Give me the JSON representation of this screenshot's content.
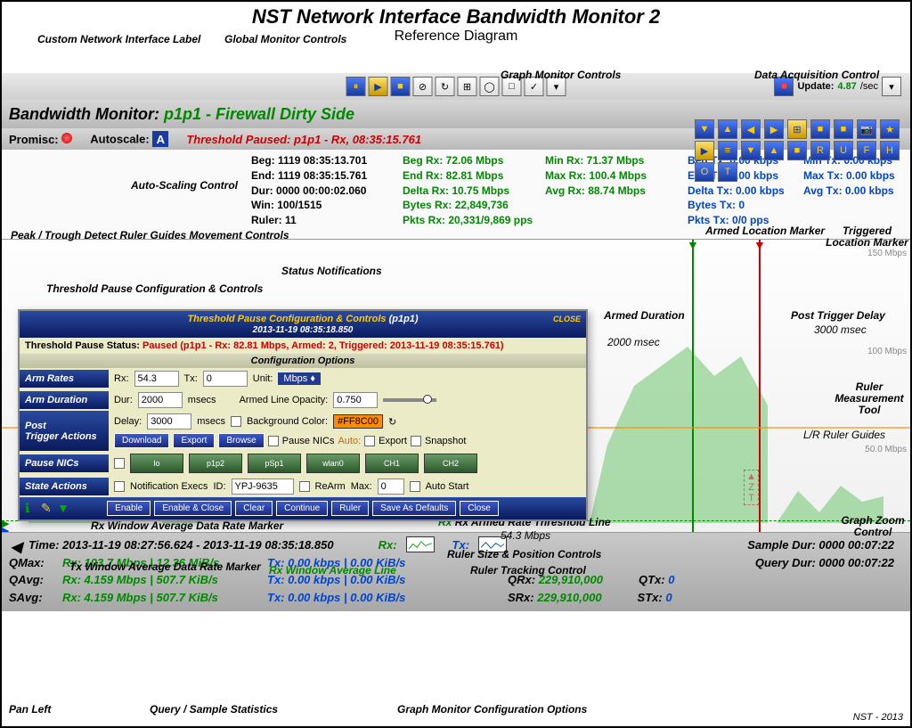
{
  "header": {
    "title": "NST Network Interface Bandwidth Monitor 2",
    "subtitle": "Reference Diagram"
  },
  "callouts": {
    "custom_label": "Custom Network\nInterface Label",
    "global_controls": "Global\nMonitor Controls",
    "graph_controls": "Graph Monitor Controls",
    "data_acq": "Data Acquisition Control",
    "autoscale": "Auto-Scaling\nControl",
    "peak_trough": "Peak / Trough Detect\nRuler Guides Movement Controls",
    "threshold_cfg": "Threshold Pause\nConfiguration & Controls",
    "status_notif": "Status\nNotifications",
    "armed_marker": "Armed\nLocation\nMarker",
    "triggered_marker": "Triggered\nLocation\nMarker",
    "armed_dur": "Armed\nDuration",
    "armed_dur_val": "2000 msec",
    "post_trigger": "Post Trigger Delay",
    "post_trigger_val": "3000 msec",
    "ruler_tool": "Ruler\nMeasurement\nTool",
    "lr_ruler": "L/R Ruler Guides",
    "rx_win_avg_marker": "Rx Window Average\nData Rate Marker",
    "tx_win_avg_marker": "Tx Window Average\nData Rate Marker",
    "rx_win_avg_line": "Rx Window Average Line",
    "rx_armed_line": "Rx Armed Rate Threshold Line",
    "rx_armed_val": "54.3 Mbps",
    "ruler_size_pos": "Ruler Size & Position Controls",
    "ruler_tracking": "Ruler Tracking Control",
    "graph_zoom": "Graph Zoom\nControl",
    "pan_left": "Pan Left",
    "query_stats": "Query / Sample Statistics",
    "graph_config": "Graph Monitor Configuration Options"
  },
  "monitor": {
    "title_prefix": "Bandwidth Monitor: ",
    "interface": "p1p1 - Firewall Dirty Side",
    "promisc_label": "Promisc:",
    "autoscale_label": "Autoscale:",
    "threshold_msg": "Threshold Paused: p1p1 - Rx, 08:35:15.761"
  },
  "data_acq": {
    "update_label": "Update:",
    "rate": "4.87",
    "per": "/sec"
  },
  "timing": {
    "beg_label": "Beg:",
    "beg": "1119 08:35:13.701",
    "end_label": "End:",
    "end": "1119 08:35:15.761",
    "dur_label": "Dur:",
    "dur": "0000 00:00:02.060",
    "win_label": "Win:",
    "win": "100/1515",
    "ruler_label": "Ruler:",
    "ruler": "11"
  },
  "rx_stats": {
    "beg": "Beg Rx: 72.06 Mbps",
    "end": "End Rx: 82.81 Mbps",
    "delta": "Delta Rx: 10.75 Mbps",
    "bytes": "Bytes Rx: 22,849,736",
    "pkts": "Pkts Rx: 20,331/9,869 pps"
  },
  "rx_minmax": {
    "min": "Min Rx: 71.37 Mbps",
    "max": "Max Rx: 100.4 Mbps",
    "avg": "Avg Rx: 88.74 Mbps"
  },
  "tx_stats": {
    "beg": "Beg Tx: 0.00 kbps",
    "end": "End Tx: 0.00 kbps",
    "delta": "Delta Tx: 0.00 kbps",
    "bytes": "Bytes Tx: 0",
    "pkts": "Pkts Tx: 0/0 pps"
  },
  "tx_minmax": {
    "min": "Min Tx: 0.00 kbps",
    "max": "Max Tx: 0.00 kbps",
    "avg": "Avg Tx: 0.00 kbps"
  },
  "config": {
    "title": "Threshold Pause Configuration & Controls",
    "iface": "(p1p1)",
    "timestamp": "2013-11-19 08:35:18.850",
    "status_label": "Threshold Pause Status:",
    "status": "Paused (p1p1 - Rx: 82.81 Mbps, Armed: 2, Triggered: 2013-11-19 08:35:15.761)",
    "section": "Configuration Options",
    "arm_rates": "Arm Rates",
    "rx_label": "Rx:",
    "rx": "54.3",
    "tx_label": "Tx:",
    "tx": "0",
    "unit_label": "Unit:",
    "unit": "Mbps",
    "arm_dur_label": "Arm Duration",
    "dur_label": "Dur:",
    "dur": "2000",
    "msecs": "msecs",
    "opacity_label": "Armed Line Opacity:",
    "opacity": "0.750",
    "post_trigger_label": "Post\nTrigger Actions",
    "delay_label": "Delay:",
    "delay": "3000",
    "bg_label": "Background Color:",
    "bg": "#FF8C00",
    "download": "Download",
    "export": "Export",
    "browse": "Browse",
    "pause_nics_cb": "Pause NICs",
    "auto_label": "Auto:",
    "export_cb": "Export",
    "snapshot_cb": "Snapshot",
    "pause_nics_label": "Pause NICs",
    "nics": [
      "lo",
      "p1p2",
      "pSp1",
      "wlan0",
      "CH1",
      "CH2"
    ],
    "state_label": "State Actions",
    "notif_cb": "Notification Execs",
    "id_label": "ID:",
    "id": "YPJ-9635",
    "rearm_cb": "ReArm",
    "max_label": "Max:",
    "max": "0",
    "autostart_cb": "Auto Start",
    "buttons": [
      "Enable",
      "Enable & Close",
      "Clear",
      "Continue",
      "Ruler",
      "Save As Defaults",
      "Close"
    ]
  },
  "bottom": {
    "time_label": "Time:",
    "time_range": "2013-11-19 08:27:56.624  -  2013-11-19 08:35:18.850",
    "rx_label": "Rx:",
    "tx_label": "Tx:",
    "sample_dur_label": "Sample Dur:",
    "sample_dur": "0000 00:07:22",
    "query_dur_label": "Query Dur:",
    "query_dur": "0000 00:07:22",
    "qmax": "QMax:",
    "qmax_rx": "Rx: 103.7 Mbps | 12.36 MiB/s",
    "qmax_tx": "Tx: 0.00 kbps | 0.00 KiB/s",
    "qavg": "QAvg:",
    "qavg_rx": "Rx: 4.159 Mbps | 507.7 KiB/s",
    "qavg_tx": "Tx: 0.00 kbps | 0.00 KiB/s",
    "savg": "SAvg:",
    "savg_rx": "Rx: 4.159 Mbps | 507.7 KiB/s",
    "savg_tx": "Tx: 0.00 kbps | 0.00 KiB/s",
    "qrx_label": "QRx:",
    "qrx": "229,910,000",
    "qtx_label": "QTx:",
    "qtx": "0",
    "srx_label": "SRx:",
    "srx": "229,910,000",
    "stx_label": "STx:",
    "stx": "0"
  },
  "y_axis": {
    "y150": "150 Mbps",
    "y100": "100 Mbps",
    "y50": "50.0 Mbps"
  },
  "footer": "NST - 2013"
}
